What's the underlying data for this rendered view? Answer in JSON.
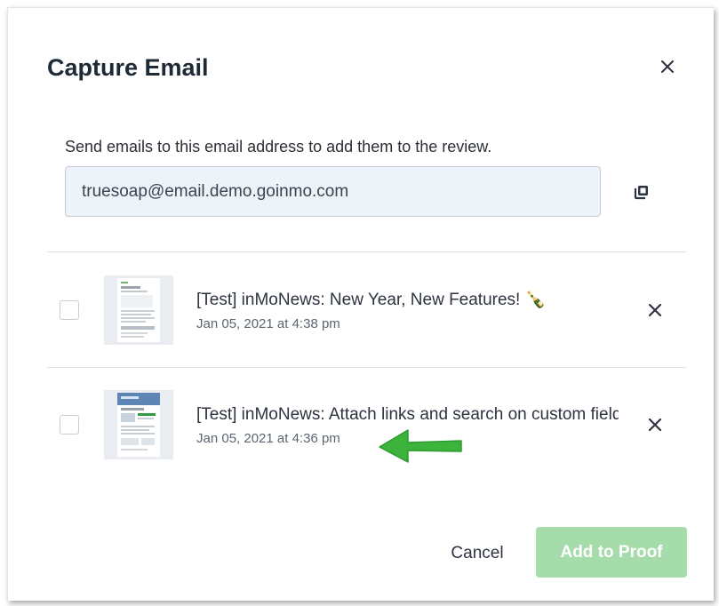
{
  "dialog": {
    "title": "Capture Email",
    "instructions": "Send emails to this email address to add them to the review.",
    "email_address": "truesoap@email.demo.goinmo.com"
  },
  "emails": [
    {
      "subject": "[Test] inMoNews: New Year, New Features! 🍾",
      "date": "Jan 05, 2021 at 4:38 pm",
      "checked": false
    },
    {
      "subject": "[Test] inMoNews: Attach links and search on custom fields",
      "date": "Jan 05, 2021 at 4:36 pm",
      "checked": false
    }
  ],
  "footer": {
    "cancel_label": "Cancel",
    "add_label": "Add to Proof"
  },
  "icons": {
    "close": "close-icon",
    "copy": "copy-icon",
    "arrow": "green-arrow-annotation"
  },
  "colors": {
    "primary_disabled": "#a5dca9",
    "annotation_arrow": "#3cb43c",
    "title": "#1f2a37"
  }
}
